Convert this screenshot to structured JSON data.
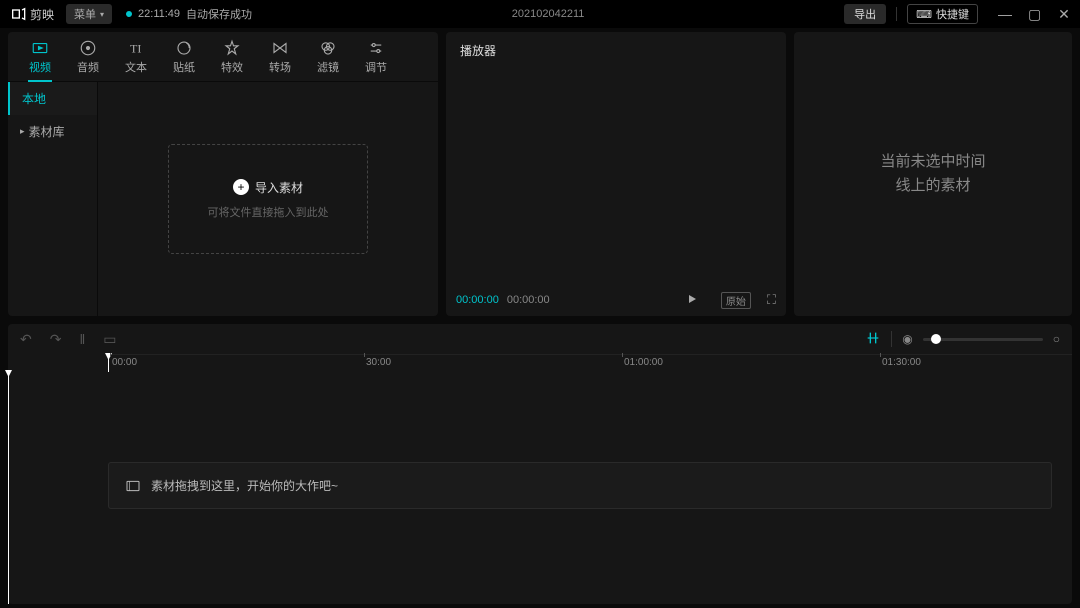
{
  "topbar": {
    "app_name": "剪映",
    "menu_label": "菜单",
    "save_time": "22:11:49",
    "save_text": "自动保存成功",
    "project_name": "202102042211",
    "export_label": "导出",
    "shortcut_label": "快捷键"
  },
  "media_tabs": {
    "video": "视频",
    "audio": "音频",
    "text": "文本",
    "sticker": "贴纸",
    "effect": "特效",
    "transition": "转场",
    "filter": "滤镜",
    "adjust": "调节"
  },
  "media_side": {
    "local": "本地",
    "library": "素材库"
  },
  "import": {
    "button": "导入素材",
    "hint": "可将文件直接拖入到此处"
  },
  "player": {
    "title": "播放器",
    "time_current": "00:00:00",
    "time_total": "00:00:00",
    "ratio": "原始"
  },
  "inspector": {
    "line1": "当前未选中时间",
    "line2": "线上的素材"
  },
  "ruler": {
    "t0": "00:00",
    "t1": "30:00",
    "t2": "01:00:00",
    "t3": "01:30:00"
  },
  "track": {
    "placeholder": "素材拖拽到这里，开始你的大作吧~"
  }
}
